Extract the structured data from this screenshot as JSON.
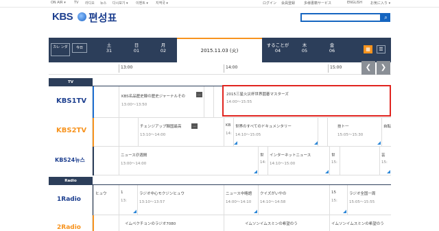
{
  "topbar": {
    "left_items": [
      "ON AIR ▾",
      "TV",
      "라디오",
      "뉴스",
      "다시보기 ▾",
      "이벤트 ▾",
      "지역국 ▾"
    ],
    "right_items": [
      "ログイン",
      "会員登録",
      "多様書籍サービス",
      "ENGLISH",
      "お気に入り ▾"
    ]
  },
  "header": {
    "logo_text": "KBS",
    "title": "편성표",
    "search_placeholder": "",
    "search_icon": "search-icon"
  },
  "date_strip": {
    "calendar_label": "カレ\nンダ",
    "today_label": "今日",
    "days": [
      {
        "dow": "土",
        "day": "31"
      },
      {
        "dow": "日",
        "day": "01"
      },
      {
        "dow": "月",
        "day": "02"
      }
    ],
    "selected": "2015.11.03 (火)",
    "days_after": [
      {
        "dow": "することが",
        "day": "04"
      },
      {
        "dow": "木",
        "day": "05"
      },
      {
        "dow": "金",
        "day": "06"
      }
    ],
    "accent": "#f7931e"
  },
  "ruler": {
    "times": [
      "13:00",
      "14:00",
      "15:00"
    ]
  },
  "sections": {
    "tv": "TV",
    "radio": "Radio"
  },
  "channels": {
    "kbs1tv": {
      "logo": "KBS1TV",
      "programs": [
        {
          "title": "KBS名品歴史韓の歴史ジャーナルその",
          "time": "13:00～13:50"
        },
        {
          "title": "2015三星火災杯世界囲碁マスターズ",
          "time": "14:00～15:55"
        }
      ]
    },
    "kbs2tv": {
      "logo": "KBS2TV",
      "programs": [
        {
          "title": "チェンジアップ韓国最高",
          "time": "13:10～14:00"
        },
        {
          "title": "KB",
          "time": "14:"
        },
        {
          "title": "世界のすべてのドキュメンタリー",
          "time": "14:10～15:05"
        },
        {
          "title": "技ト一",
          "time": "15:05～15:30"
        },
        {
          "title": "自転",
          "time": ""
        }
      ]
    },
    "kbs24": {
      "logo": "KBS24뉴스",
      "programs": [
        {
          "title": "ニュース＠週間",
          "time": "13:00～14:00"
        },
        {
          "title": "世",
          "time": "14:"
        },
        {
          "title": "インターネットニュース",
          "time": "14:10～15:00"
        },
        {
          "title": "世",
          "time": "15:"
        },
        {
          "title": "芸",
          "time": "15:"
        }
      ]
    },
    "radio1": {
      "logo": "1Radio",
      "programs": [
        {
          "title": "ヒュウ",
          "time": ""
        },
        {
          "title": "1",
          "time": "13:"
        },
        {
          "title": "ラジオ中心モクジンヒュウ",
          "time": "13:10～13:57"
        },
        {
          "title": "ニュース中略語",
          "time": "14:00～14:10"
        },
        {
          "title": "クイズがいやの",
          "time": "14:10～14:58"
        },
        {
          "title": "15",
          "time": "15:"
        },
        {
          "title": "ラジオ全国一周",
          "time": "15:05～15:55"
        }
      ]
    },
    "radio2": {
      "logo": "2Radio",
      "programs": [
        {
          "title": "イムペクチョンのラジオ7080",
          "time": ""
        },
        {
          "title": "イムソンイムスミンの希望のう",
          "time": ""
        },
        {
          "title": "イムソンイムスミンの希望のう",
          "time": ""
        }
      ]
    }
  },
  "colors": {
    "navy": "#2c3e5a",
    "highlight": "#e0231e",
    "blue": "#1565c0"
  }
}
